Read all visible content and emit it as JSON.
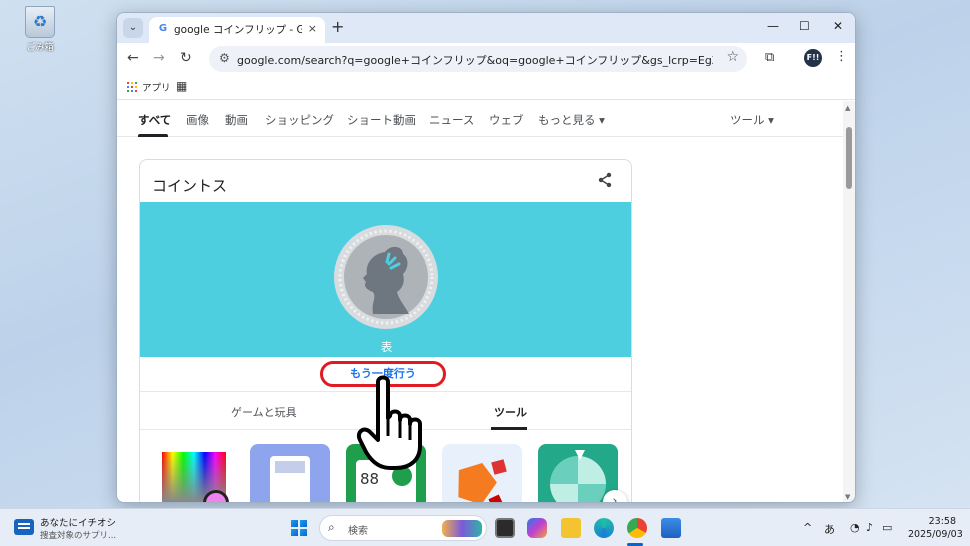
{
  "desktop": {
    "recycle_bin_label": "ごみ箱"
  },
  "browser": {
    "tab_title": "google コインフリップ - Google 検索",
    "tab_close": "×",
    "new_tab": "+",
    "win_minimize": "—",
    "win_maximize": "☐",
    "win_close": "✕",
    "url": "google.com/search?q=google+コインフリップ&oq=google+コインフリップ&gs_lcrp=EgZjaHJvbWUyBggAE...",
    "profile_initials": "F!!",
    "bookmark_apps": "アプリ"
  },
  "search_tabs": [
    "すべて",
    "画像",
    "動画",
    "ショッピング",
    "ショート動画",
    "ニュース",
    "ウェブ",
    "もっと見る ▾"
  ],
  "tools_label": "ツール ▾",
  "coin_card": {
    "title": "コイントス",
    "result": "表",
    "again_button": "もう一度行う",
    "subtabs": [
      "ゲームと玩具",
      "ツール"
    ]
  },
  "taskbar": {
    "news_title": "あなたにイチオシ",
    "news_sub": "捜査対象のサプリ...",
    "search_placeholder": "検索",
    "ime": "あ",
    "time": "23:58",
    "date": "2025/09/03"
  },
  "colors": {
    "coin_panel": "#4dcfe0",
    "highlight": "#e01b24",
    "link": "#1a73e8"
  }
}
